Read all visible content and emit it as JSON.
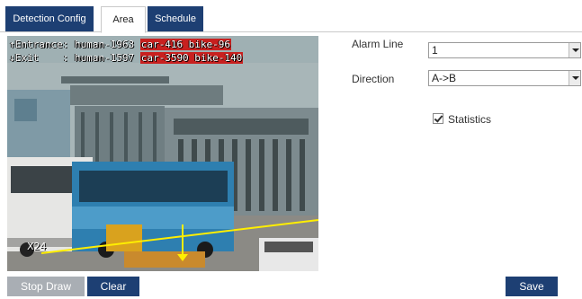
{
  "tabs": [
    {
      "label": "Detection Config"
    },
    {
      "label": "Area"
    },
    {
      "label": "Schedule"
    }
  ],
  "active_tab": "Area",
  "video": {
    "osd_line1_prefix": "↑Entrance: human-1963 ",
    "osd_line1_highlight": "car-416 bike-96",
    "osd_line2_prefix": "↓Exit    : human-1597 ",
    "osd_line2_highlight": "car-3590 bike-140",
    "line_label": "X24"
  },
  "form": {
    "alarm_line_label": "Alarm Line",
    "alarm_line_value": "1",
    "direction_label": "Direction",
    "direction_value": "A->B",
    "statistics_label": "Statistics",
    "statistics_checked": true
  },
  "buttons": {
    "stop_draw": "Stop Draw",
    "clear": "Clear",
    "save": "Save"
  },
  "colors": {
    "accent": "#1d3f73",
    "disabled_button": "#a9aeb4",
    "osd_highlight": "#c8201f",
    "line_color": "#ffee00"
  }
}
